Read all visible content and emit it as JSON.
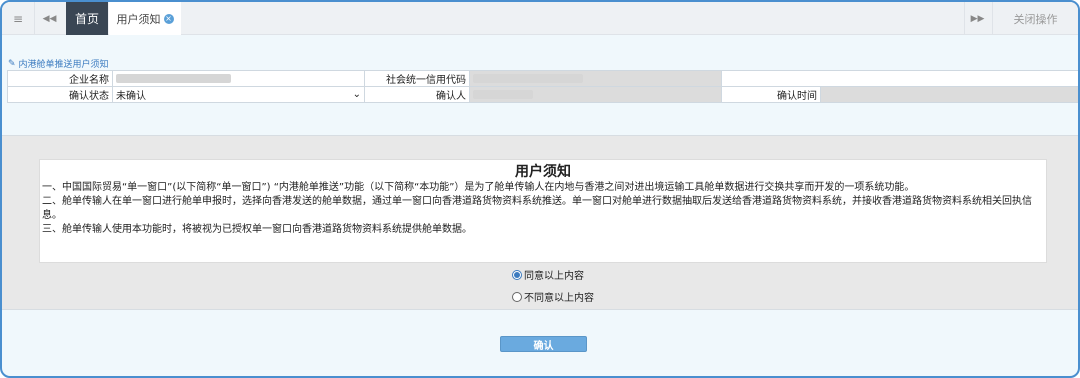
{
  "topbar": {
    "menu_icon": "≡",
    "back_icon": "◀◀",
    "home_tab": "首页",
    "notice_tab": "用户须知",
    "close_icon": "×",
    "forward_icon": "▶▶",
    "close_ops": "关闭操作"
  },
  "section": {
    "edit_icon": "✎",
    "title": "内港舱单推送用户须知"
  },
  "info": {
    "company_label": "企业名称",
    "credit_label": "社会统一信用代码",
    "status_label": "确认状态",
    "status_value": "未确认",
    "dropdown_icon": "⌄",
    "confirmer_label": "确认人",
    "confirm_time_label": "确认时间"
  },
  "notice": {
    "title": "用户须知",
    "lines": [
      "一、中国国际贸易“单一窗口”(以下简称“单一窗口”) “内港舱单推送”功能（以下简称“本功能”）是为了舱单传输人在内地与香港之间对进出境运输工具舱单数据进行交换共享而开发的一项系统功能。",
      "二、舱单传输人在单一窗口进行舱单申报时，选择向香港发送的舱单数据，通过单一窗口向香港道路货物资料系统推送。单一窗口对舱单进行数据抽取后发送给香港道路货物资料系统，并接收香港道路货物资料系统相关回执信息。",
      "三、舱单传输人使用本功能时，将被视为已授权单一窗口向香港道路货物资料系统提供舱单数据。"
    ]
  },
  "radios": {
    "agree": "同意以上内容",
    "disagree": "不同意以上内容"
  },
  "confirm_button": "确认"
}
